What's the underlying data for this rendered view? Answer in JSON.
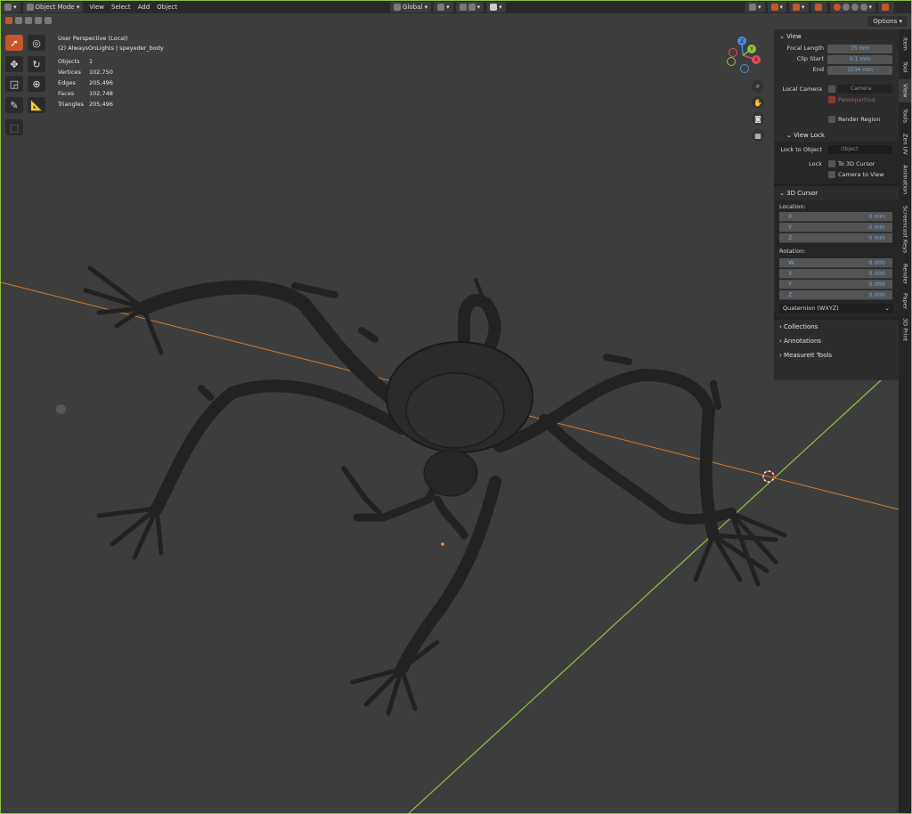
{
  "header": {
    "mode": "Object Mode",
    "menu": [
      "View",
      "Select",
      "Add",
      "Object"
    ],
    "transform_orientation": "Global",
    "options": "Options"
  },
  "overlay": {
    "view_name": "User Perspective (Local)",
    "collection": "(2) AlwaysOnLights | speyeder_body",
    "stats": [
      {
        "k": "Objects",
        "v": "1"
      },
      {
        "k": "Vertices",
        "v": "102,750"
      },
      {
        "k": "Edges",
        "v": "205,496"
      },
      {
        "k": "Faces",
        "v": "102,748"
      },
      {
        "k": "Triangles",
        "v": "205,496"
      }
    ]
  },
  "gizmo": {
    "x": "X",
    "y": "Y",
    "z": "Z"
  },
  "panel": {
    "view": {
      "title": "View",
      "focal_label": "Focal Length",
      "focal_value": "75 mm",
      "clip_start_label": "Clip Start",
      "clip_start_value": "0.1 mm",
      "end_label": "End",
      "end_value": "1534 mm",
      "local_camera_label": "Local Camera",
      "camera_placeholder": "Camera",
      "passepartout": "Passepartout",
      "render_region": "Render Region"
    },
    "view_lock": {
      "title": "View Lock",
      "lock_to_object_label": "Lock to Object",
      "object_placeholder": "Object",
      "lock_label": "Lock",
      "to_3d_cursor": "To 3D Cursor",
      "camera_to_view": "Camera to View"
    },
    "cursor": {
      "title": "3D Cursor",
      "location_label": "Location:",
      "location": [
        {
          "axis": "X",
          "value": "0 mm"
        },
        {
          "axis": "Y",
          "value": "0 mm"
        },
        {
          "axis": "Z",
          "value": "0 mm"
        }
      ],
      "rotation_label": "Rotation:",
      "rotation": [
        {
          "axis": "W",
          "value": "0.000"
        },
        {
          "axis": "X",
          "value": "0.000"
        },
        {
          "axis": "Y",
          "value": "0.000"
        },
        {
          "axis": "Z",
          "value": "0.000"
        }
      ],
      "rotation_mode": "Quaternion (WXYZ)"
    },
    "collapsed": [
      "Collections",
      "Annotations",
      "MeasureIt Tools"
    ]
  },
  "tabs": [
    "Item",
    "Tool",
    "View",
    "Tools",
    "Zen UV",
    "Animation",
    "Screencast Keys",
    "Render",
    "Paper",
    "3D Print"
  ],
  "colors": {
    "accent": "#c4572c",
    "x_axis": "#d67a28",
    "y_axis": "#8cc43d",
    "value_blue": "#6fa8dc"
  }
}
